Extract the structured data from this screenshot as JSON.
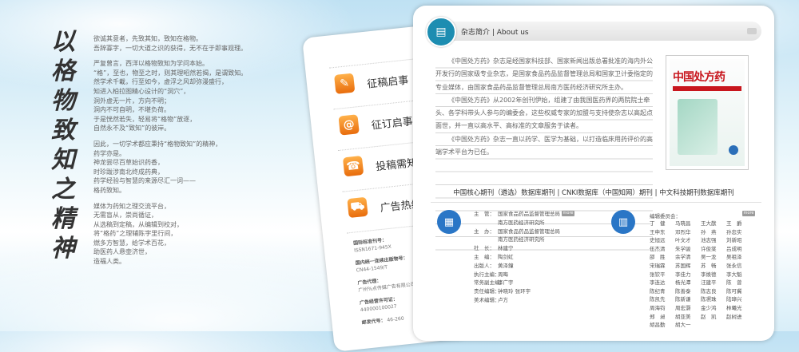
{
  "calligraphy": [
    "以",
    "格",
    "物",
    "致",
    "知",
    "之",
    "精",
    "神"
  ],
  "prose": [
    "欲诚其意者，先致其知，致知在格物。\n吾辞寡字，一切大道之识的获得，无不在于即事观理。",
    "严复曾言，西洋以格物致知为学问本始。\n“格”，至也，物至之时，则其理昭然若揭，是谓致知。\n然学术千載，行至如今，虚浮之风却弥漫盛行，\n知进入柏拉图精心设计的“洞穴”，\n洞外虚无一片，方向不明；\n洞内不可自明，不堪负荷。\n于是恍然若失，轻易将“格物”放逐，\n自然永不及“致知”的彼岸。",
    "因此，一切学术都应秉持“格物致知”的精神，\n药学亦是。\n神龙尝尽百草始识药香，\n时珍跋涉南北终成药典，\n药学经验与智慧的来源尽汇一词——\n格药致知。",
    "媒体为药知之理交流平台，\n无需盲从，崇尚循证，\n从选稿到定稿，从编辑到校对，\n将“格药”之理辅陈字里行间，\n燃多方智慧，给学术百花，\n助医药人悬壶济世，\n造福人类。"
  ],
  "menu": {
    "items": [
      {
        "label": "征稿启事",
        "icon": "pen-icon"
      },
      {
        "label": "征订启事",
        "icon": "at-icon"
      },
      {
        "label": "投稿需知",
        "icon": "phone-icon"
      },
      {
        "label": "广告热线",
        "icon": "car-icon"
      }
    ],
    "info": [
      {
        "label": "国际标准刊号：",
        "value": "ISSN1671-945X"
      },
      {
        "label": "国内统一连续出版物号：",
        "value": "CN44-1549/T"
      },
      {
        "label": "广告代理：",
        "value": "广州%点传媒广告有限公司"
      },
      {
        "label": "广告经营许可证：",
        "value": "440000100027"
      },
      {
        "label": "邮发代号：",
        "value": "46-260"
      }
    ]
  },
  "about": {
    "title": "杂志简介 | About us",
    "paragraphs": [
      "《中国处方药》杂志是经国家科技部、国家新闻出版总署批准的海内外公开发行的国家级专业杂志，是国家食品药品监督管理总局和国家卫计委指定的专业媒体，由国家食品药品监督管理总局南方医药经济研究所主办。",
      "《中国处方药》从2002年创刊伊始，组建了由我国医药界的两院院士牵头、各学科带头人参与的编委会，这些权威专家的加盟与支持使杂志以高起点面世，并一直以高水平、高标准的文章服务于读者。",
      "《中国处方药》杂志一直以药学、医学为基础，以打造临床用药评价的高端学术平台为已任。"
    ],
    "cover_title": "中国处方药"
  },
  "indexing": "中国核心期刊（遴选）数据库期刊 | CNKI数据库（中国知网）期刊 | 中文科技期刊数据库期刊",
  "more_label": "more",
  "staff": [
    {
      "k": "主　管：",
      "v": "国家食品药品监督管理总局"
    },
    {
      "k": "",
      "v": "南方医药经济研究所"
    },
    {
      "k": "主　办：",
      "v": "国家食品药品监督管理总局"
    },
    {
      "k": "",
      "v": "南方医药经济研究所"
    },
    {
      "k": "社　长：",
      "v": "林建宁"
    },
    {
      "k": "主　编：",
      "v": "陶剑虹"
    },
    {
      "k": "出版人：",
      "v": "黄泽鐘"
    },
    {
      "k": "执行主编：",
      "v": "周晦"
    },
    {
      "k": "常务副主编：",
      "v": "李广宇"
    },
    {
      "k": "责任编辑：",
      "v": "钟晓玲 张环宇"
    },
    {
      "k": "美术编辑：",
      "v": "卢方"
    }
  ],
  "board_title": "编辑委员会：",
  "board": [
    "丁　健",
    "马晓昌",
    "王大猷",
    "王　爵",
    "王申东",
    "邓烈华",
    "孙　燕",
    "孙忠实",
    "史旭远",
    "叶文才",
    "池志强",
    "刘新昭",
    "伍杰清",
    "朱学骏",
    "许俊棠",
    "吕成明",
    "邵　胜",
    "余学清",
    "吴一龙",
    "吴祖泽",
    "宋瑞霖",
    "苏国辉",
    "苏　畅",
    "张永信",
    "张钦平",
    "李佳力",
    "李焕德",
    "李大魁",
    "李连达",
    "杨光潭",
    "汪建平",
    "陈　曾",
    "陈纪青",
    "陈善泰",
    "陈志良",
    "陈可冀",
    "陈凯先",
    "陈新谦",
    "陈凞珠",
    "陆璋兴",
    "周海钧",
    "周宏灏",
    "金少鸿",
    "林曦光",
    "郑　昶",
    "胡亚美",
    "赵　凯",
    "赵树进",
    "胡昌勤",
    "胡大一"
  ]
}
